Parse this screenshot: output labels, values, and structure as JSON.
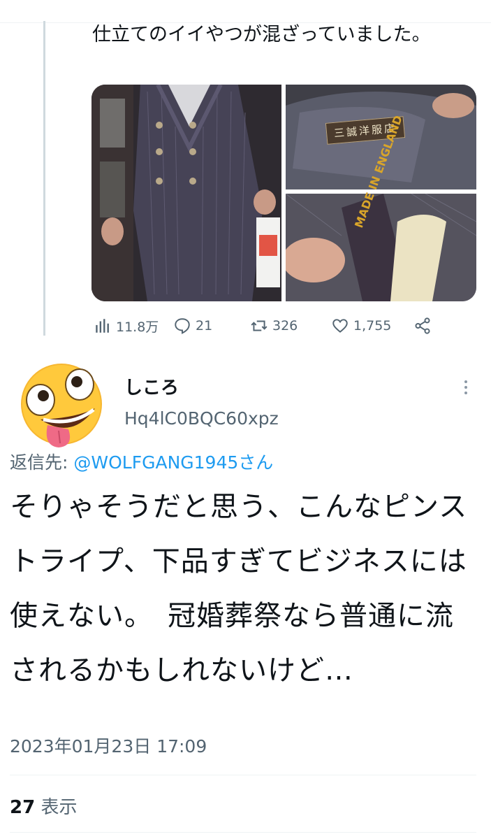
{
  "parent_tweet": {
    "text": "仕立てのイイやつが混ざっていました。",
    "media_label_1": "三誠洋服店",
    "media_label_2": "MADE IN ENGLAND",
    "stats": {
      "views": "11.8万",
      "replies": "21",
      "retweets": "326",
      "likes": "1,755"
    }
  },
  "reply": {
    "display_name_fragment": "しころ",
    "handle_fragment": "Hq4lC0BQC60xpz",
    "reply_prefix": "返信先:",
    "reply_to_handle": "@WOLFGANG1945さん",
    "body": "そりゃそうだと思う、こんなピンストライプ、下品すぎてビジネスには使えない。　冠婚葬祭なら普通に流されるかもしれないけど…",
    "timestamp": "2023年01月23日 17:09",
    "view_count": "27",
    "view_label": "表示"
  },
  "colors": {
    "text_primary": "#0f1419",
    "text_secondary": "#536471",
    "link": "#1d9bf0",
    "divider": "#eff3f4"
  }
}
